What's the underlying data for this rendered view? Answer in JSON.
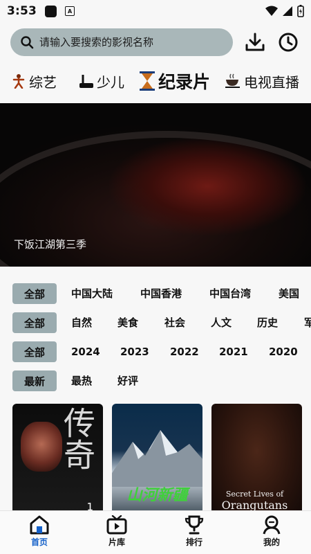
{
  "status": {
    "time": "3:53"
  },
  "search": {
    "placeholder": "请输入要搜索的影视名称"
  },
  "tabs": [
    {
      "label": "综艺",
      "icon": "figure-icon",
      "active": false
    },
    {
      "label": "少儿",
      "icon": "kid-icon",
      "active": false
    },
    {
      "label": "纪录片",
      "icon": "hourglass-icon",
      "active": true
    },
    {
      "label": "电视直播",
      "icon": "coffee-icon",
      "active": false
    }
  ],
  "banner": {
    "caption": "下饭江湖第三季"
  },
  "filters": {
    "region": {
      "selected": "全部",
      "options": [
        "中国大陆",
        "中国香港",
        "中国台湾",
        "美国"
      ]
    },
    "genre": {
      "selected": "全部",
      "options": [
        "自然",
        "美食",
        "社会",
        "人文",
        "历史",
        "军"
      ]
    },
    "year": {
      "selected": "全部",
      "options": [
        "2024",
        "2023",
        "2022",
        "2021",
        "2020"
      ]
    },
    "sort": {
      "selected": "最新",
      "options": [
        "最热",
        "好评"
      ]
    }
  },
  "posters": [
    {
      "title": "传奇",
      "badge": "1"
    },
    {
      "title": "山河新疆"
    },
    {
      "title_line1": "Secret Lives of",
      "title_line2": "Orangutans"
    }
  ],
  "nav": [
    {
      "label": "首页",
      "icon": "home-icon",
      "active": true
    },
    {
      "label": "片库",
      "icon": "tv-icon",
      "active": false
    },
    {
      "label": "排行",
      "icon": "trophy-icon",
      "active": false
    },
    {
      "label": "我的",
      "icon": "user-icon",
      "active": false
    }
  ],
  "colors": {
    "chip": "#9aabaf",
    "search": "#a9b7b9",
    "nav_active": "#1561c9"
  }
}
